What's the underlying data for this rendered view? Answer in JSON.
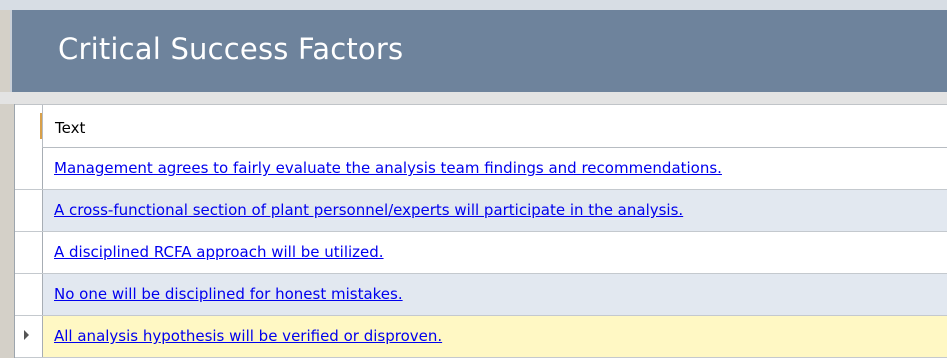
{
  "header": {
    "title": "Critical Success Factors"
  },
  "grid": {
    "column_header": "Text",
    "rows": [
      {
        "text": "Management agrees to fairly evaluate the analysis team findings and recommendations."
      },
      {
        "text": "A cross-functional section of plant personnel/experts will participate in the analysis."
      },
      {
        "text": "A disciplined RCFA approach will be utilized."
      },
      {
        "text": "No one will be disciplined for honest mistakes."
      },
      {
        "text": "All analysis hypothesis will be verified or disproven."
      }
    ],
    "current_row_index": 4
  },
  "colors": {
    "header_background": "#6e839c",
    "header_text": "#ffffff",
    "row_alt_background": "#e2e8f0",
    "row_active_background": "#fff8c4",
    "link_color": "#0000ee"
  }
}
